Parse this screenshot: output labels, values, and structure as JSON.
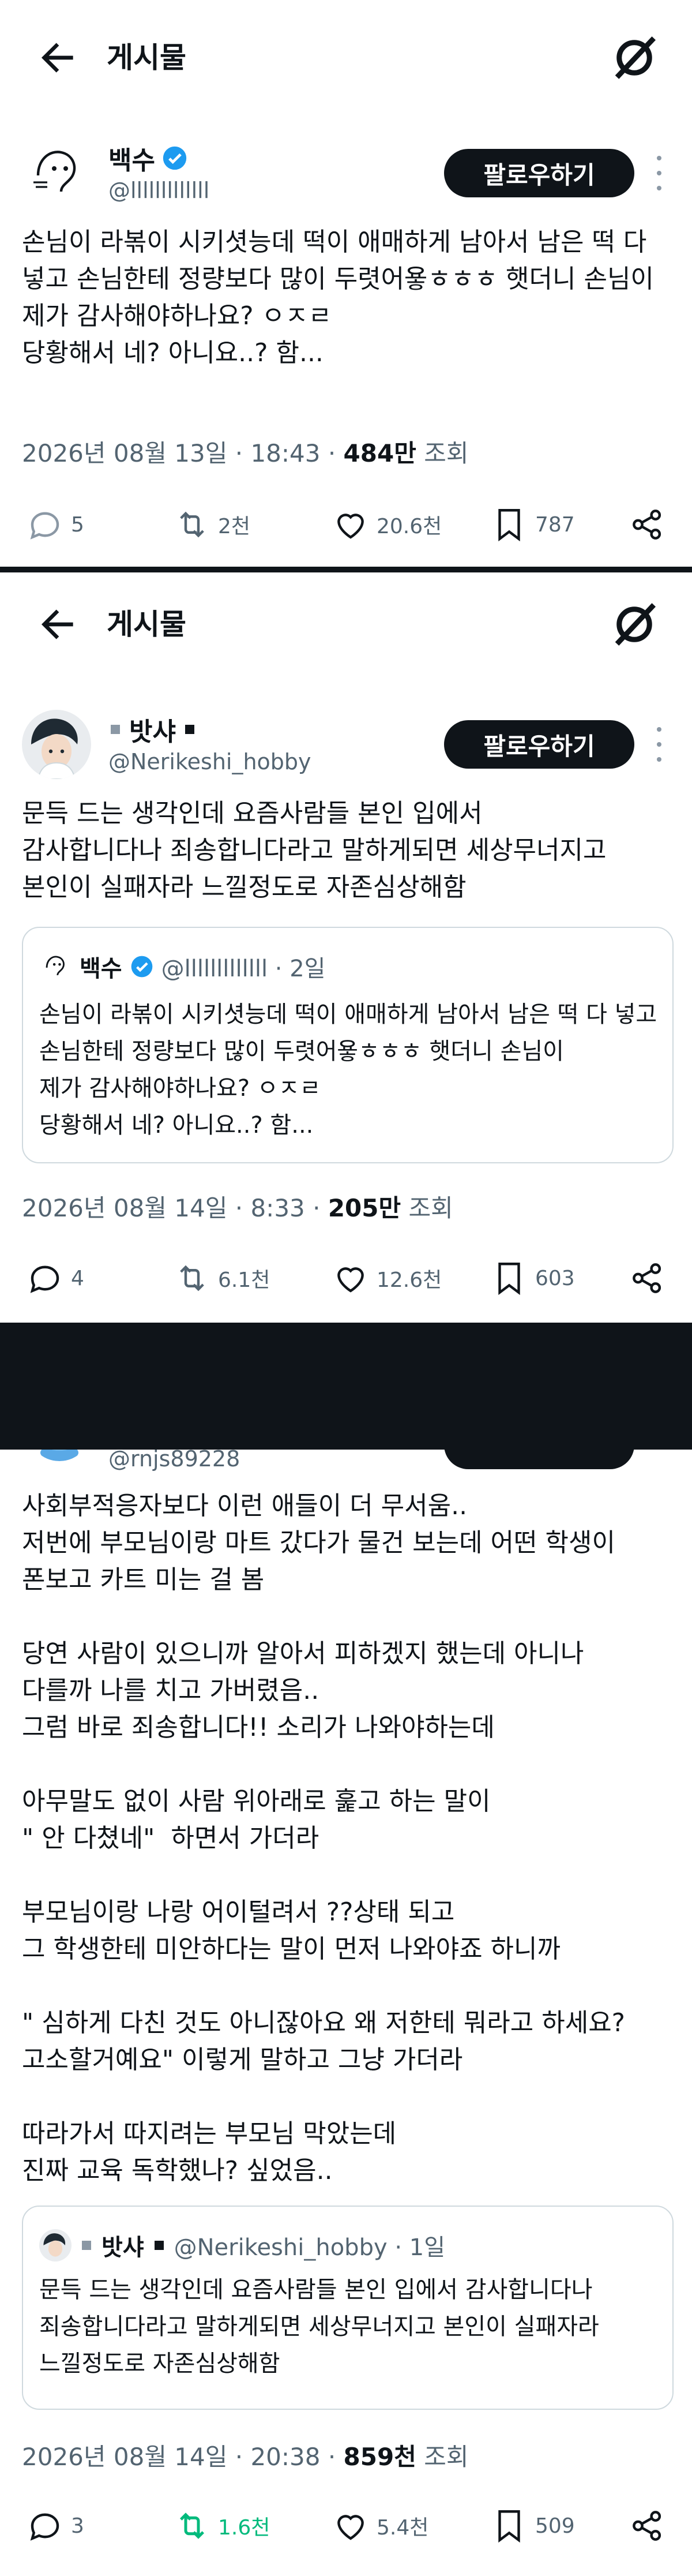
{
  "topbar": {
    "title": "게시물"
  },
  "post1": {
    "author": {
      "name": "백수",
      "handle": "@lllllllllllll"
    },
    "follow_label": "팔로우하기",
    "text": "손님이 라볶이 시키셧능데 떡이 애매하게 남아서 남은 떡 다 넣고 손님한테 정량보다 많이 두렷어욯ㅎㅎㅎ 햇더니 손님이\n제가 감사해야하나요? ㅇㅈㄹ\n당황해서 네? 아니요..? 함...",
    "meta_date": "2026년 08월 13일 · 18:43 · ",
    "meta_views": "484만",
    "meta_views_label": " 조회",
    "stats": {
      "replies": "5",
      "reposts": "2천",
      "likes": "20.6천",
      "bookmarks": "787"
    }
  },
  "post2": {
    "author": {
      "name": "밧샤",
      "handle": "@Nerikeshi_hobby"
    },
    "follow_label": "팔로우하기",
    "text": "문득 드는 생각인데 요즘사람들 본인 입에서\n감사합니다나 죄송합니다라고 말하게되면 세상무너지고\n본인이 실패자라 느낄정도로 자존심상해함",
    "quote": {
      "name": "백수",
      "handle": "@lllllllllllll · 2일",
      "text": "손님이 라볶이 시키셧능데 떡이 애매하게 남아서 남은 떡 다 넣고 손님한테 정량보다 많이 두렷어욯ㅎㅎㅎ 햇더니 손님이\n제가 감사해야하나요? ㅇㅈㄹ\n당황해서 네? 아니요..? 함..."
    },
    "meta_date": "2026년 08월 14일 · 8:33 · ",
    "meta_views": "205만",
    "meta_views_label": " 조회",
    "stats": {
      "replies": "4",
      "reposts": "6.1천",
      "likes": "12.6천",
      "bookmarks": "603"
    }
  },
  "post3": {
    "author": {
      "handle": "@rnjs89228"
    },
    "text": "사회부적응자보다 이런 애들이 더 무서움..\n저번에 부모님이랑 마트 갔다가 물건 보는데 어떤 학생이\n폰보고 카트 미는 걸 봄\n\n당연 사람이 있으니까 알아서 피하겠지 했는데 아니나\n다를까 나를 치고 가버렸음..\n그럼 바로 죄송합니다!! 소리가 나와야하는데\n\n아무말도 없이 사람 위아래로 훑고 하는 말이\n\" 안 다쳤네\"  하면서 가더라\n\n부모님이랑 나랑 어이털려서 ??상태 되고\n그 학생한테 미안하다는 말이 먼저 나와야죠 하니까\n\n\" 심하게 다친 것도 아니잖아요 왜 저한테 뭐라고 하세요?\n고소할거예요\" 이렇게 말하고 그냥 가더라\n\n따라가서 따지려는 부모님 막았는데\n진짜 교육 독학했나? 싶었음..",
    "quote": {
      "name": "밧샤",
      "handle": "@Nerikeshi_hobby · 1일",
      "text": "문득 드는 생각인데 요즘사람들 본인 입에서 감사합니다나\n죄송합니다라고 말하게되면 세상무너지고 본인이 실패자라\n느낄정도로 자존심상해함"
    },
    "meta_date": "2026년 08월 14일 · 20:38 · ",
    "meta_views": "859천",
    "meta_views_label": " 조회",
    "stats": {
      "replies": "3",
      "reposts": "1.6천",
      "likes": "5.4천",
      "bookmarks": "509"
    }
  },
  "colors": {
    "text": "#0f1419",
    "muted": "#536471",
    "verified": "#1d9bf0",
    "repost_active": "#00ba7c",
    "divider": "#0f1419"
  },
  "icons": [
    "back-arrow-icon",
    "x-logo-icon",
    "verified-icon",
    "more-icon",
    "reply-icon",
    "repost-icon",
    "like-icon",
    "bookmark-icon",
    "share-icon"
  ]
}
